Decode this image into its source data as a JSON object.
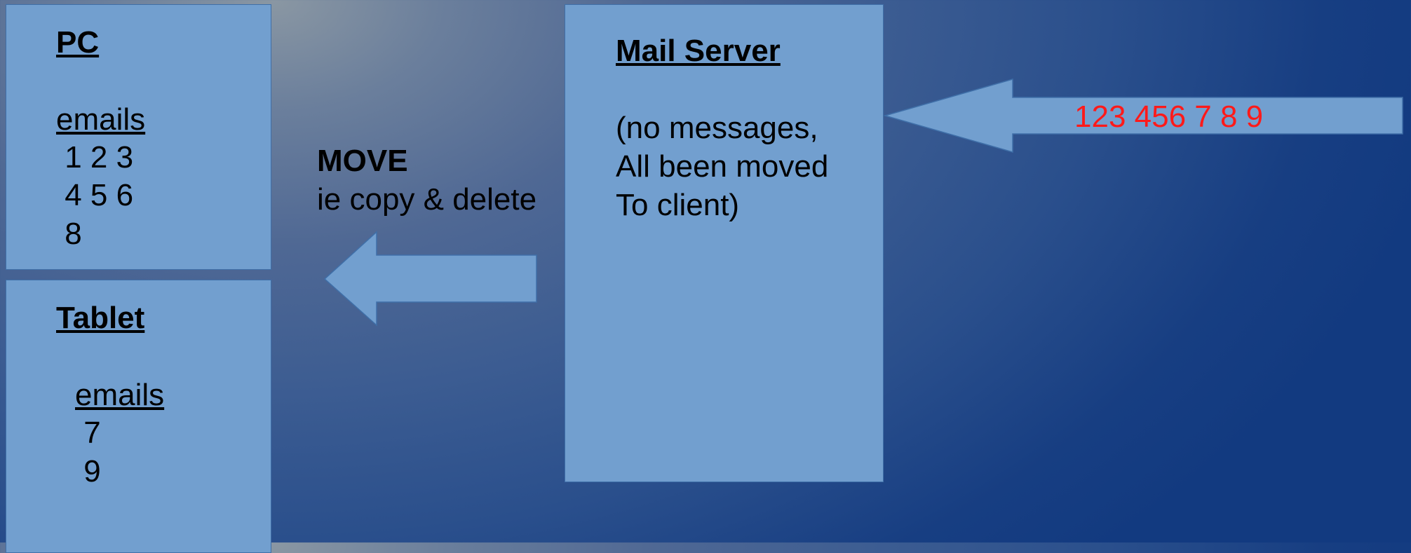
{
  "pc": {
    "title": "PC",
    "emails_label": "emails",
    "email_lines": [
      " 1 2 3",
      " 4 5 6",
      " 8"
    ]
  },
  "tablet": {
    "title": "Tablet",
    "emails_label": "emails",
    "email_lines": [
      " 7",
      " 9"
    ]
  },
  "move": {
    "title": "MOVE",
    "subtitle": "ie copy & delete"
  },
  "mail_server": {
    "title": "Mail Server",
    "status_lines": [
      "(no messages,",
      "All been moved",
      "To client)"
    ]
  },
  "incoming": {
    "label": "123 456 7 8 9",
    "color": "#ff1a1a"
  },
  "colors": {
    "box_fill": "#729fcf",
    "box_border": "#3f6fa8",
    "background_dark": "#123a80",
    "background_light": "#8a97a3"
  }
}
